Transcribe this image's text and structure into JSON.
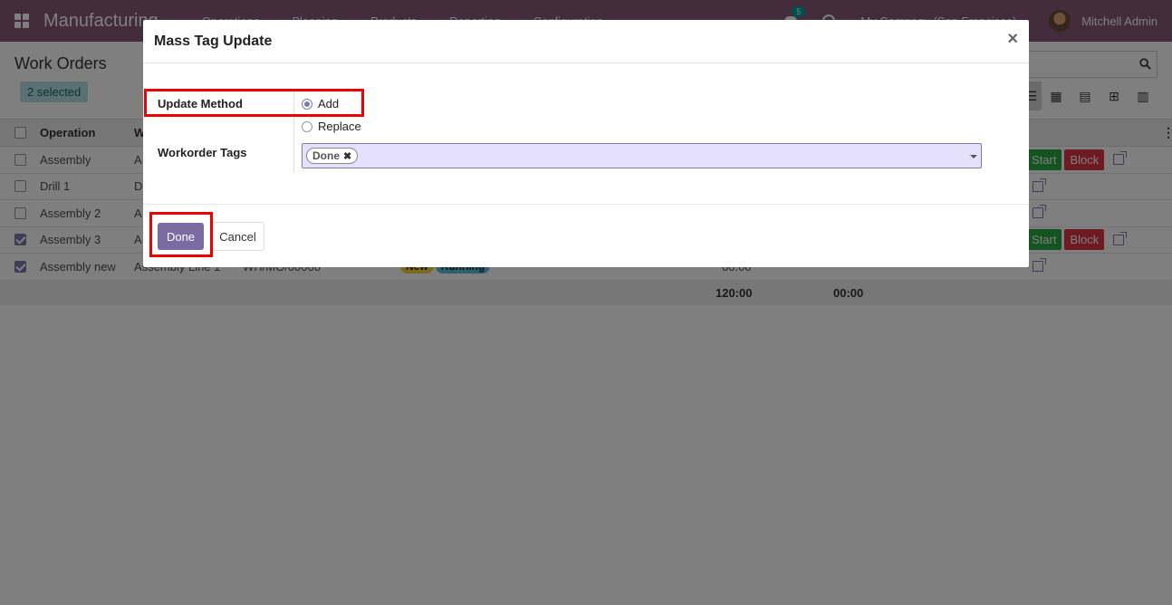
{
  "navbar": {
    "app_name": "Manufacturing",
    "menu": [
      "Operations",
      "Planning",
      "Products",
      "Reporting",
      "Configuration"
    ],
    "messages_count": "5",
    "company": "My Company (San Francisco)",
    "user": "Mitchell Admin"
  },
  "control_panel": {
    "title": "Work Orders",
    "selected_badge": "2 selected"
  },
  "list": {
    "columns": [
      "Operation",
      "W"
    ],
    "rows": [
      {
        "operation": "Assembly",
        "wc": "A",
        "checked": false,
        "start": "Start",
        "block": "Block"
      },
      {
        "operation": "Drill 1",
        "wc": "D",
        "checked": false
      },
      {
        "operation": "Assembly 2",
        "wc": "A",
        "checked": false
      },
      {
        "operation": "Assembly 3",
        "wc": "A",
        "checked": true,
        "start": "Start",
        "block": "Block"
      },
      {
        "operation": "Assembly new",
        "wc": "Assembly Line 1",
        "checked": true,
        "ref": "WH/MO/00008",
        "tag_new": "New",
        "tag_running": "Running",
        "duration": "60:00"
      }
    ],
    "totals": {
      "expected": "120:00",
      "real": "00:00"
    }
  },
  "modal": {
    "title": "Mass Tag Update",
    "close": "×",
    "update_method_label": "Update Method",
    "option_add": "Add",
    "option_replace": "Replace",
    "selected_method": "Add",
    "tags_label": "Workorder Tags",
    "tags": [
      "Done"
    ],
    "tag_remove": "✖",
    "done_button": "Done",
    "cancel_button": "Cancel"
  },
  "colors": {
    "navbar": "#875a7b",
    "primary": "#7c6ba3",
    "highlight": "#ee0000",
    "start": "#28a745",
    "block": "#dc3545"
  }
}
